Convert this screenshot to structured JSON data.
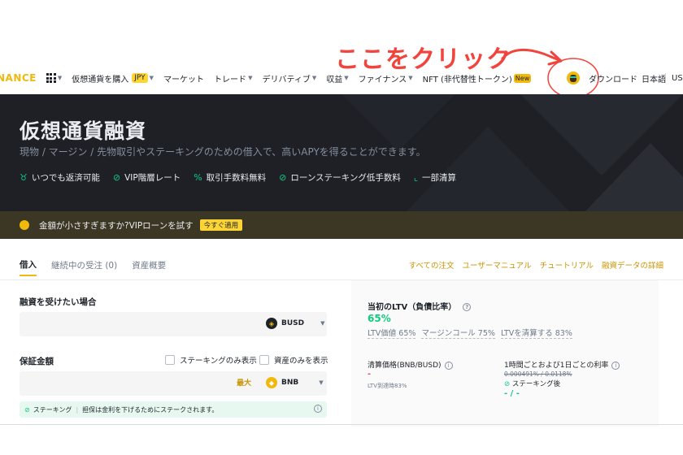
{
  "annotation": {
    "text": "ここをクリック",
    "color": "#f0443c"
  },
  "nav": {
    "logo": "NANCE",
    "items": [
      {
        "label": "仮想通貨を購入",
        "badge": "JPY",
        "has_caret": true
      },
      {
        "label": "マーケット",
        "has_caret": false
      },
      {
        "label": "トレード",
        "has_caret": true
      },
      {
        "label": "デリバティブ",
        "has_caret": true
      },
      {
        "label": "収益",
        "has_caret": true
      },
      {
        "label": "ファイナンス",
        "has_caret": true
      },
      {
        "label": "NFT (非代替性トークン)",
        "new_badge": "New"
      }
    ],
    "download": "ダウンロード",
    "language": "日本語",
    "currency": "USD"
  },
  "hero": {
    "title": "仮想通貨融資",
    "subtitle": "現物 / マージン / 先物取引やステーキングのための借入で、高いAPYを得ることができます。",
    "features": [
      {
        "icon": "badge-icon",
        "label": "いつでも返済可能"
      },
      {
        "icon": "check-circle-icon",
        "label": "VIP階層レート"
      },
      {
        "icon": "percent-icon",
        "label": "取引手数料無料"
      },
      {
        "icon": "check-circle-icon",
        "label": "ローンステーキング低手数料"
      },
      {
        "icon": "chart-icon",
        "label": "一部清算"
      }
    ]
  },
  "promo": {
    "text": "金額が小さすぎますか?VIPローンを試す",
    "button": "今すぐ適用"
  },
  "tabs": {
    "items": [
      "借入",
      "継続中の受注 (0)",
      "資産概要"
    ],
    "links": [
      "すべての注文",
      "ユーザーマニュアル",
      "チュートリアル",
      "融資データの詳細"
    ]
  },
  "borrow": {
    "label": "融資を受けたい場合",
    "coin": "BUSD"
  },
  "collateral": {
    "label": "保証金額",
    "staking_only": "ステーキングのみ表示",
    "assets_only": "資産のみを表示",
    "max": "最大",
    "coin": "BNB"
  },
  "stake_note": {
    "tag": "ステーキング",
    "text": "担保は金利を下げるためにステークされます。"
  },
  "ltv": {
    "title": "当初のLTV（負債比率）",
    "value": "65%",
    "details": [
      "LTV価値 65%",
      "マージンコール 75%",
      "LTVを清算する 83%"
    ]
  },
  "liquidation": {
    "title": "清算価格(BNB/BUSD)",
    "value": "-",
    "note": "LTV到達時83%"
  },
  "rate": {
    "title": "1時間ごとおよび1日ごとの利率",
    "old": "0.000491% / 0.0118%",
    "after_label": "ステーキング後",
    "after_value": "- / -"
  }
}
